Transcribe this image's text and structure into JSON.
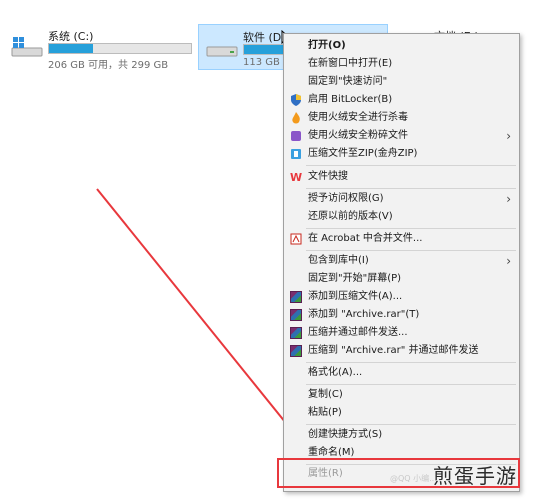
{
  "drives": [
    {
      "name": "系统 (C:)",
      "info": "206 GB 可用，共 299 GB",
      "used_fraction": 0.31
    },
    {
      "name": "软件 (D:)",
      "info": "113 GB",
      "used_fraction": 0.5
    },
    {
      "name": "文档 (E:)",
      "info": ""
    }
  ],
  "menu": {
    "items": [
      {
        "label": "打开(O)",
        "icon": "none",
        "bold": true
      },
      {
        "label": "在新窗口中打开(E)",
        "icon": "none"
      },
      {
        "label": "固定到\"快速访问\"",
        "icon": "none"
      },
      {
        "label": "启用 BitLocker(B)",
        "icon": "shield-icon"
      },
      {
        "label": "使用火绒安全进行杀毒",
        "icon": "huorong-icon"
      },
      {
        "label": "使用火绒安全粉碎文件",
        "icon": "shredder-icon",
        "submenu": true
      },
      {
        "label": "压缩文件至ZIP(金舟ZIP)",
        "icon": "zip-icon"
      },
      {
        "label": "文件快搜",
        "icon": "wps-icon"
      },
      {
        "label": "授予访问权限(G)",
        "icon": "none",
        "submenu": true
      },
      {
        "label": "还原以前的版本(V)",
        "icon": "none"
      },
      {
        "label": "在 Acrobat 中合并文件...",
        "icon": "acrobat-icon"
      },
      {
        "label": "包含到库中(I)",
        "icon": "none",
        "submenu": true
      },
      {
        "label": "固定到\"开始\"屏幕(P)",
        "icon": "none"
      },
      {
        "label": "添加到压缩文件(A)...",
        "icon": "winrar-icon"
      },
      {
        "label": "添加到 \"Archive.rar\"(T)",
        "icon": "winrar-icon"
      },
      {
        "label": "压缩并通过邮件发送...",
        "icon": "winrar-icon"
      },
      {
        "label": "压缩到 \"Archive.rar\" 并通过邮件发送",
        "icon": "winrar-icon"
      },
      {
        "label": "格式化(A)...",
        "icon": "none"
      },
      {
        "label": "复制(C)",
        "icon": "none"
      },
      {
        "label": "粘贴(P)",
        "icon": "none"
      },
      {
        "label": "创建快捷方式(S)",
        "icon": "none"
      },
      {
        "label": "重命名(M)",
        "icon": "none"
      },
      {
        "label": "属性(R)",
        "icon": "none",
        "disabled": true
      }
    ]
  },
  "watermark": {
    "text": "煎蛋手游",
    "sub": "@QQ 小编..."
  },
  "colors": {
    "highlight": "#e8383d",
    "drive_bar": "#26a0da",
    "selection": "#cce8ff"
  }
}
